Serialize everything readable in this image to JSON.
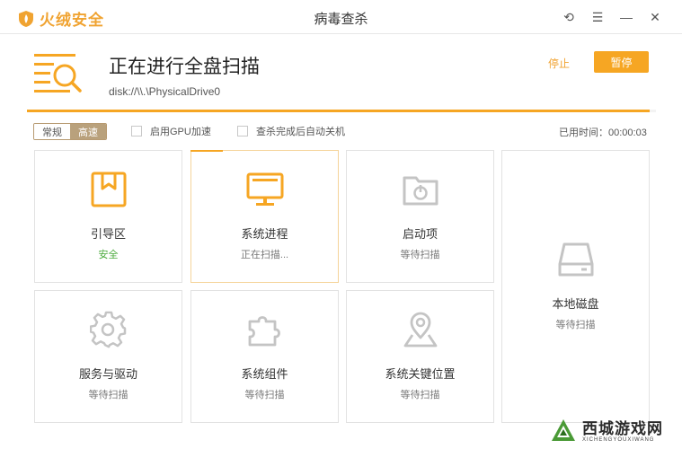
{
  "app": {
    "brand": "火绒安全",
    "window_title": "病毒查杀"
  },
  "window_controls": {
    "back": "⟲",
    "menu": "☰",
    "minimize": "—",
    "close": "✕"
  },
  "scan": {
    "title": "正在进行全盘扫描",
    "path": "disk://\\\\.\\PhysicalDrive0",
    "stop_label": "停止",
    "pause_label": "暂停",
    "progress": 0.99
  },
  "options": {
    "modes": [
      "常规",
      "高速"
    ],
    "gpu_label": "启用GPU加速",
    "shutdown_label": "查杀完成后自动关机",
    "elapsed_label": "已用时间：",
    "elapsed_value": "00:00:03"
  },
  "cards": [
    {
      "name": "引导区",
      "status": "安全",
      "icon": "bookmark-box-icon"
    },
    {
      "name": "系统进程",
      "status": "正在扫描...",
      "icon": "monitor-icon"
    },
    {
      "name": "启动项",
      "status": "等待扫描",
      "icon": "folder-power-icon"
    },
    {
      "name": "本地磁盘",
      "status": "等待扫描",
      "icon": "hard-disk-icon"
    },
    {
      "name": "服务与驱动",
      "status": "等待扫描",
      "icon": "gear-icon"
    },
    {
      "name": "系统组件",
      "status": "等待扫描",
      "icon": "puzzle-icon"
    },
    {
      "name": "系统关键位置",
      "status": "等待扫描",
      "icon": "location-pin-icon"
    }
  ],
  "colors": {
    "accent": "#f6a623",
    "safe": "#4aaa3b",
    "inactive_icon": "#c4c4c4"
  },
  "watermark": {
    "main": "西城游戏网",
    "sub": "XICHENGYOUXIWANG"
  }
}
